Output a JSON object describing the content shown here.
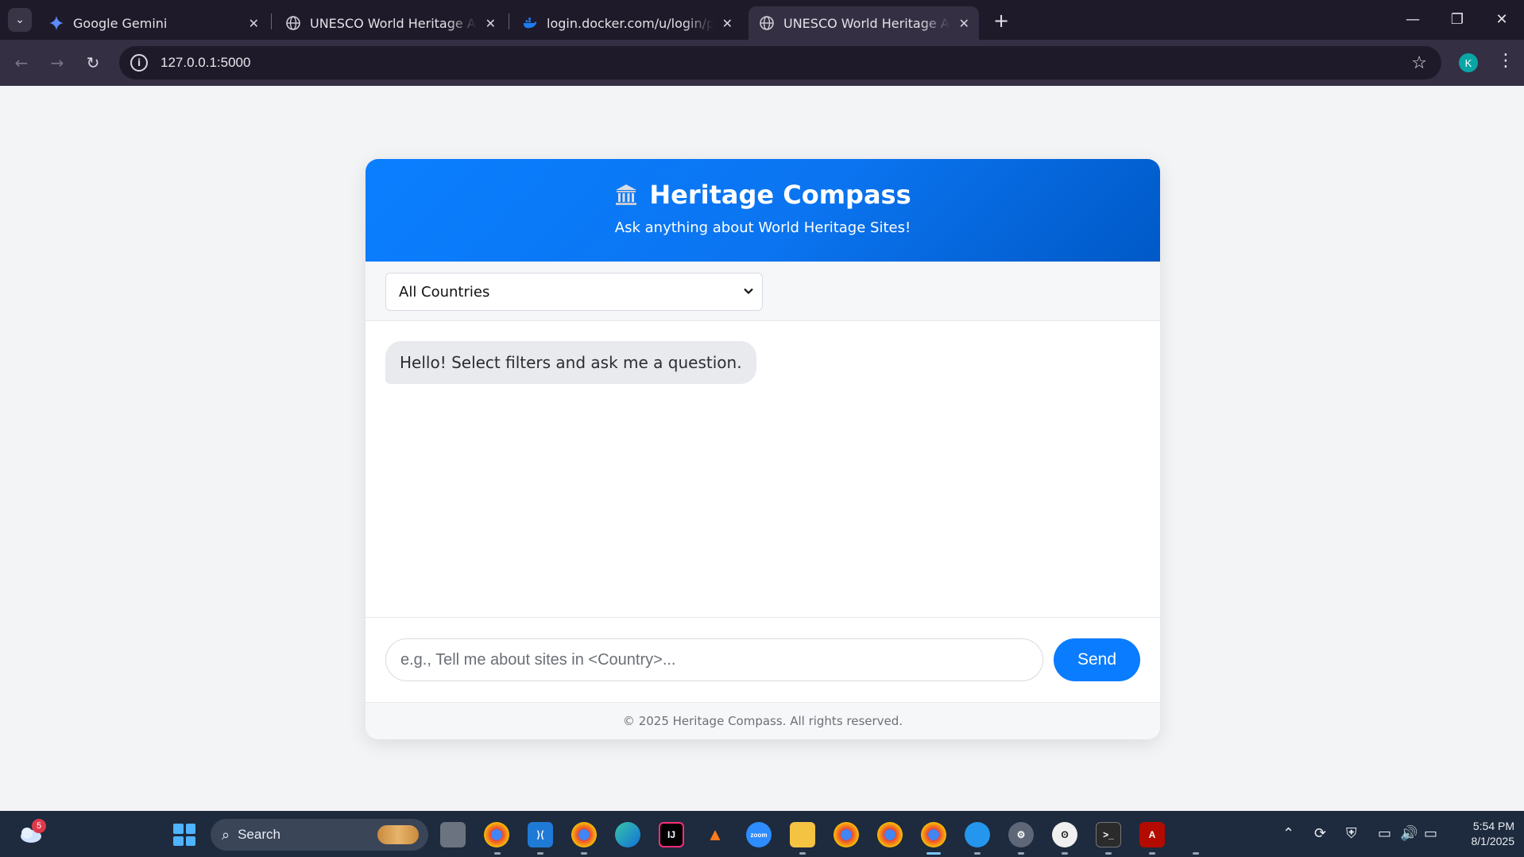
{
  "browser": {
    "tabs": [
      {
        "title": "Google Gemini",
        "icon": "gemini-icon",
        "active": false
      },
      {
        "title": "UNESCO World Heritage Assistant",
        "icon": "globe-icon",
        "active": false
      },
      {
        "title": "login.docker.com/u/login/password",
        "icon": "docker-icon",
        "active": false
      },
      {
        "title": "UNESCO World Heritage Assistant",
        "icon": "globe-icon",
        "active": true
      }
    ],
    "url": "127.0.0.1:5000",
    "profile_initial": "K"
  },
  "app": {
    "title": "Heritage Compass",
    "subtitle": "Ask anything about World Heritage Sites!",
    "country_filter": {
      "selected": "All Countries"
    },
    "messages": [
      {
        "role": "bot",
        "text": "Hello! Select filters and ask me a question."
      }
    ],
    "input": {
      "placeholder": "e.g., Tell me about sites in <Country>...",
      "value": ""
    },
    "send_label": "Send",
    "footer": "© 2025 Heritage Compass. All rights reserved.",
    "colors": {
      "primary": "#0a7cff",
      "header_dark": "#0059c7"
    }
  },
  "taskbar": {
    "notification_count": "5",
    "search_label": "Search",
    "time": "5:54 PM",
    "date": "8/1/2025"
  }
}
